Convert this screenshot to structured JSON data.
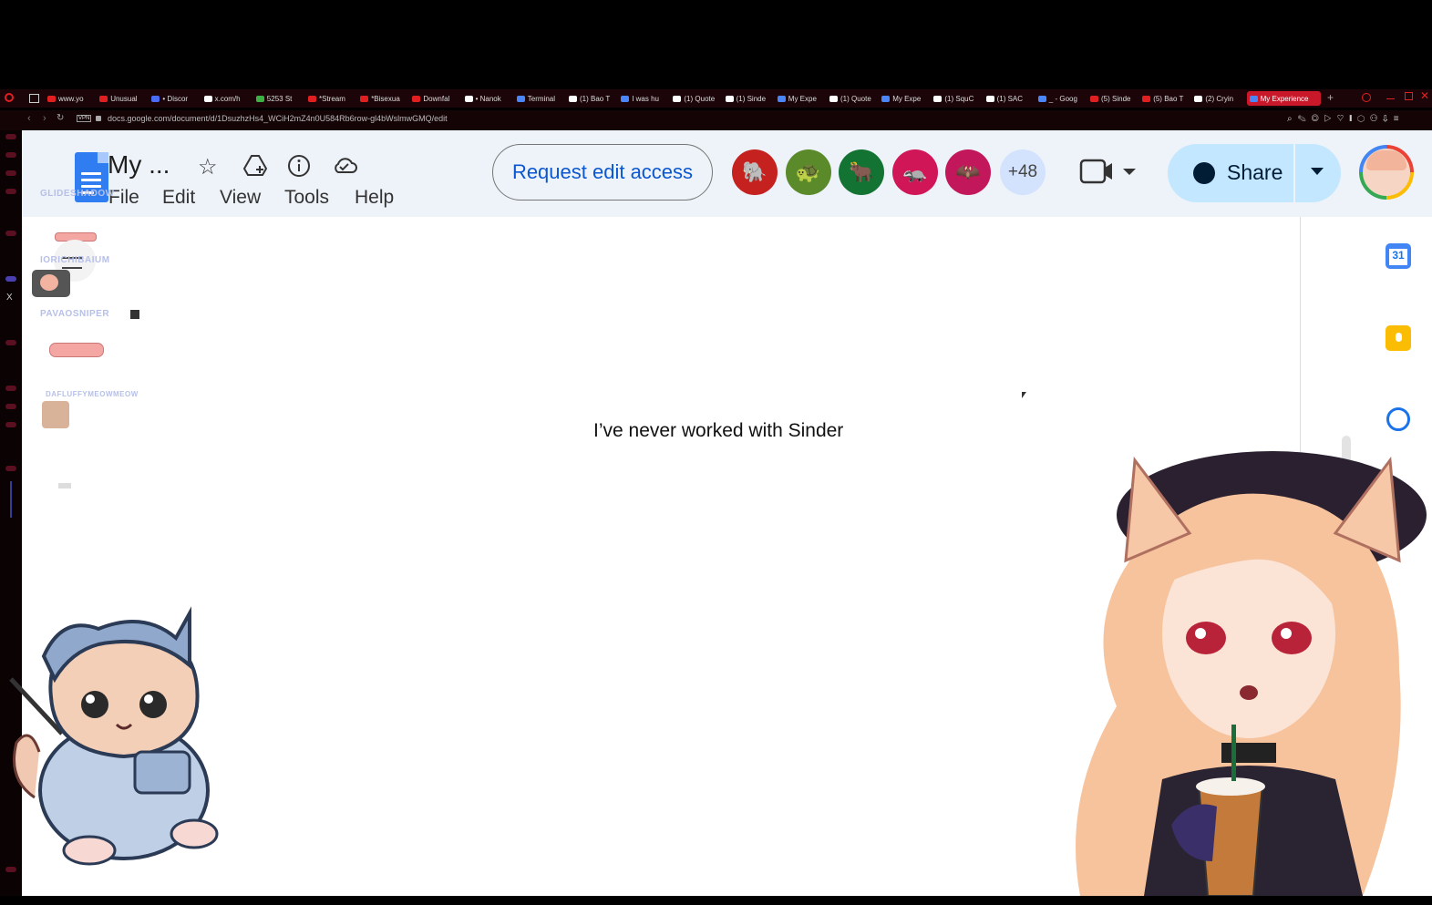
{
  "browser": {
    "tabs": [
      {
        "label": "www.yo",
        "color": "#e02020"
      },
      {
        "label": "Unusual",
        "color": "#e02020"
      },
      {
        "label": "• Discor",
        "color": "#4a6cf7"
      },
      {
        "label": "x.com/h",
        "color": "#ffffff"
      },
      {
        "label": "5253 St",
        "color": "#3cb043"
      },
      {
        "label": "*Stream",
        "color": "#e02020"
      },
      {
        "label": "*Bisexua",
        "color": "#e02020"
      },
      {
        "label": "Downfal",
        "color": "#e02020"
      },
      {
        "label": "• Nanok",
        "color": "#ffffff"
      },
      {
        "label": "Terminal",
        "color": "#4a86f7"
      },
      {
        "label": "(1) Bao T",
        "color": "#ffffff"
      },
      {
        "label": "I was hu",
        "color": "#4a86f7"
      },
      {
        "label": "(1) Quote",
        "color": "#ffffff"
      },
      {
        "label": "(1) Sinde",
        "color": "#ffffff"
      },
      {
        "label": "My Expe",
        "color": "#4a86f7"
      },
      {
        "label": "(1) Quote",
        "color": "#ffffff"
      },
      {
        "label": "My Expe",
        "color": "#4a86f7"
      },
      {
        "label": "(1) SquC",
        "color": "#ffffff"
      },
      {
        "label": "(1) SAC",
        "color": "#ffffff"
      },
      {
        "label": "_ - Goog",
        "color": "#4a86f7"
      },
      {
        "label": "(5) Sinde",
        "color": "#e02020"
      },
      {
        "label": "(5) Bao T",
        "color": "#e02020"
      },
      {
        "label": "(2) Cryin",
        "color": "#ffffff"
      },
      {
        "label": "My Experience",
        "color": "#4a86f7"
      }
    ],
    "new_tab": "+",
    "vpn_badge": "VPN",
    "url": "docs.google.com/document/d/1DsuzhzHs4_WCiH2mZ4n0U584Rb6row-gl4bWslmwGMQ/edit"
  },
  "docs": {
    "title": "My ...",
    "menus": [
      "File",
      "Edit",
      "View",
      "Tools",
      "Help"
    ],
    "request_edit": "Request edit access",
    "collaborators": [
      {
        "icon": "elephant-icon",
        "glyph": "🐘",
        "color": "#c5221f"
      },
      {
        "icon": "turtle-icon",
        "glyph": "🐢",
        "color": "#5a8a2a"
      },
      {
        "icon": "ox-icon",
        "glyph": "🐂",
        "color": "#137333"
      },
      {
        "icon": "badger-icon",
        "glyph": "🦡",
        "color": "#d01656"
      },
      {
        "icon": "bat-icon",
        "glyph": "🦇",
        "color": "#c2185b"
      }
    ],
    "more_collaborators": "+48",
    "share_label": "Share",
    "body_text": "I’ve never worked with Sinder",
    "calendar_day": "31"
  },
  "stream_overlay": {
    "chat_names": [
      "GLIDESHADOW",
      "IORICHIBAIUM",
      "PAVAOSNIPER",
      "DAFLUFFYMEOWMEOW"
    ]
  }
}
